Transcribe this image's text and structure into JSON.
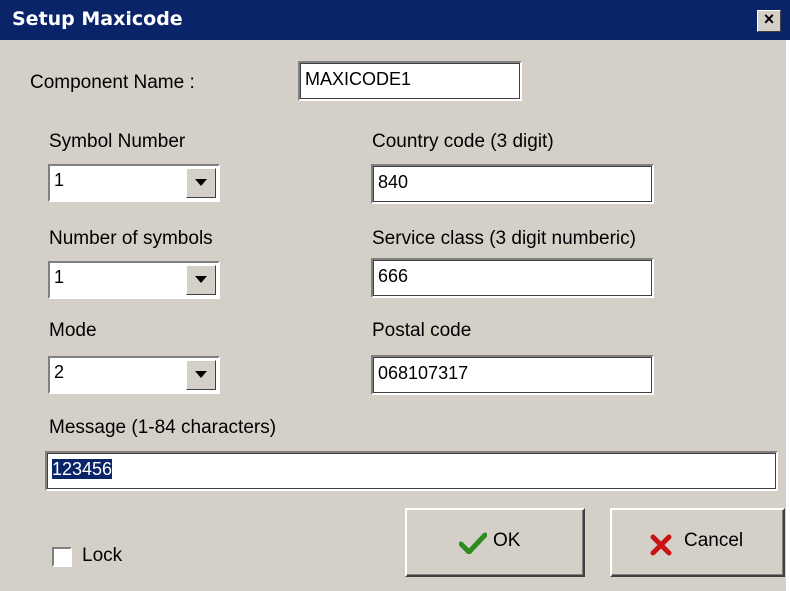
{
  "window": {
    "title": "Setup Maxicode",
    "close_glyph": "×"
  },
  "form": {
    "component_name": {
      "label": "Component Name :",
      "value": "MAXICODE1"
    },
    "symbol_number": {
      "label": "Symbol Number",
      "value": "1"
    },
    "number_of_symbols": {
      "label": "Number of symbols",
      "value": "1"
    },
    "mode": {
      "label": "Mode",
      "value": "2"
    },
    "country_code": {
      "label": "Country code (3 digit)",
      "value": "840"
    },
    "service_class": {
      "label": "Service class (3 digit numberic)",
      "value": "666"
    },
    "postal_code": {
      "label": "Postal code",
      "value": "068107317"
    },
    "message": {
      "label": "Message (1-84 characters)",
      "value": "123456",
      "selected": true
    },
    "lock": {
      "label": "Lock",
      "checked": false
    }
  },
  "buttons": {
    "ok": {
      "label": "OK",
      "icon": "checkmark-icon",
      "color": "#2e8b1e"
    },
    "cancel": {
      "label": "Cancel",
      "icon": "x-cross-icon",
      "color": "#c81414"
    }
  },
  "colors": {
    "titlebar": "#0a246a",
    "face": "#d4d0c8",
    "selection": "#0a246a"
  }
}
